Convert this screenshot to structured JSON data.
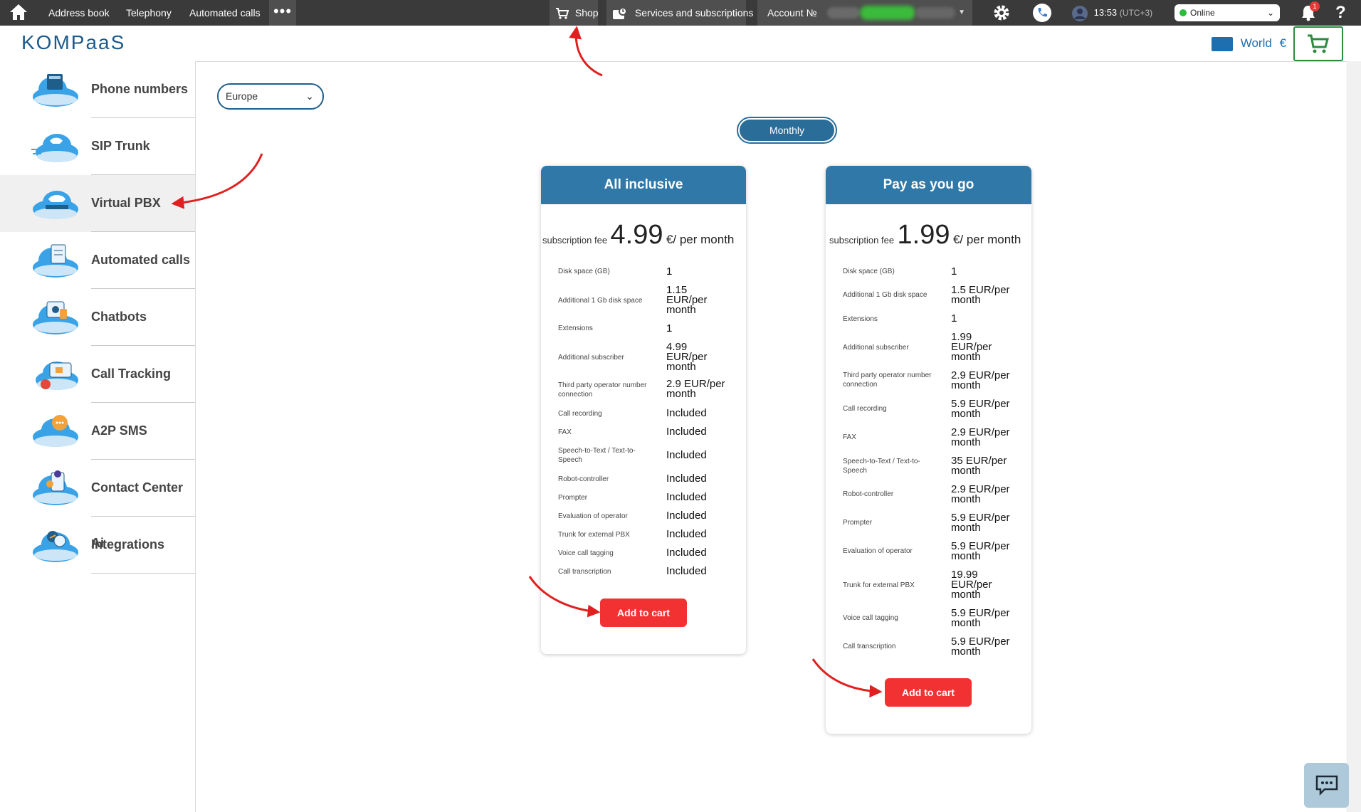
{
  "topbar": {
    "nav": [
      "Address book",
      "Telephony",
      "Automated calls"
    ],
    "more": "•••",
    "shop": "Shop",
    "services": "Services and subscriptions",
    "account_label": "Account №",
    "time": "13:53",
    "timezone": "(UTC+3)",
    "status": "Online",
    "notifications": "1",
    "help": "?"
  },
  "header": {
    "logo": "KOMPaaS",
    "region": "World",
    "currency": "€"
  },
  "sidebar": {
    "items": [
      {
        "label": "Phone numbers"
      },
      {
        "label": "SIP Trunk"
      },
      {
        "label": "Virtual PBX"
      },
      {
        "label": "Automated calls"
      },
      {
        "label": "Chatbots"
      },
      {
        "label": "Call Tracking"
      },
      {
        "label": "A2P SMS"
      },
      {
        "label": "Contact Center Ai"
      },
      {
        "label": "Integrations"
      }
    ]
  },
  "filters": {
    "region_select": "Europe",
    "period": "Monthly"
  },
  "plans": [
    {
      "title": "All inclusive",
      "fee_label": "subscription fee",
      "price": "4.99",
      "unit": "€/ per month",
      "rows": [
        {
          "k": "Disk space (GB)",
          "v": "1"
        },
        {
          "k": "Additional 1 Gb disk space",
          "v": "1.15 EUR/per month"
        },
        {
          "k": "Extensions",
          "v": "1"
        },
        {
          "k": "Additional subscriber",
          "v": "4.99 EUR/per month"
        },
        {
          "k": "Third party operator number connection",
          "v": "2.9 EUR/per month"
        },
        {
          "k": "Call recording",
          "v": "Included"
        },
        {
          "k": "FAX",
          "v": "Included"
        },
        {
          "k": "Speech-to-Text / Text-to-Speech",
          "v": "Included"
        },
        {
          "k": "Robot-controller",
          "v": "Included"
        },
        {
          "k": "Prompter",
          "v": "Included"
        },
        {
          "k": "Evaluation of operator",
          "v": "Included"
        },
        {
          "k": "Trunk for external PBX",
          "v": "Included"
        },
        {
          "k": "Voice call tagging",
          "v": "Included"
        },
        {
          "k": "Call transcription",
          "v": "Included"
        }
      ],
      "button": "Add to cart"
    },
    {
      "title": "Pay as you go",
      "fee_label": "subscription fee",
      "price": "1.99",
      "unit": "€/ per month",
      "rows": [
        {
          "k": "Disk space (GB)",
          "v": "1"
        },
        {
          "k": "Additional 1 Gb disk space",
          "v": "1.5 EUR/per month"
        },
        {
          "k": "Extensions",
          "v": "1"
        },
        {
          "k": "Additional subscriber",
          "v": "1.99 EUR/per month"
        },
        {
          "k": "Third party operator number connection",
          "v": "2.9 EUR/per month"
        },
        {
          "k": "Call recording",
          "v": "5.9 EUR/per month"
        },
        {
          "k": "FAX",
          "v": "2.9 EUR/per month"
        },
        {
          "k": "Speech-to-Text / Text-to-Speech",
          "v": "35 EUR/per month"
        },
        {
          "k": "Robot-controller",
          "v": "2.9 EUR/per month"
        },
        {
          "k": "Prompter",
          "v": "5.9 EUR/per month"
        },
        {
          "k": "Evaluation of operator",
          "v": "5.9 EUR/per month"
        },
        {
          "k": "Trunk for external PBX",
          "v": "19.99 EUR/per month"
        },
        {
          "k": "Voice call tagging",
          "v": "5.9 EUR/per month"
        },
        {
          "k": "Call transcription",
          "v": "5.9 EUR/per month"
        }
      ],
      "button": "Add to cart"
    }
  ],
  "colors": {
    "topbar": "#3a3a3a",
    "card_header": "#2f78a8",
    "cta": "#f23232",
    "cart": "#2e8b3e",
    "annotation_arrow": "#e02020"
  }
}
